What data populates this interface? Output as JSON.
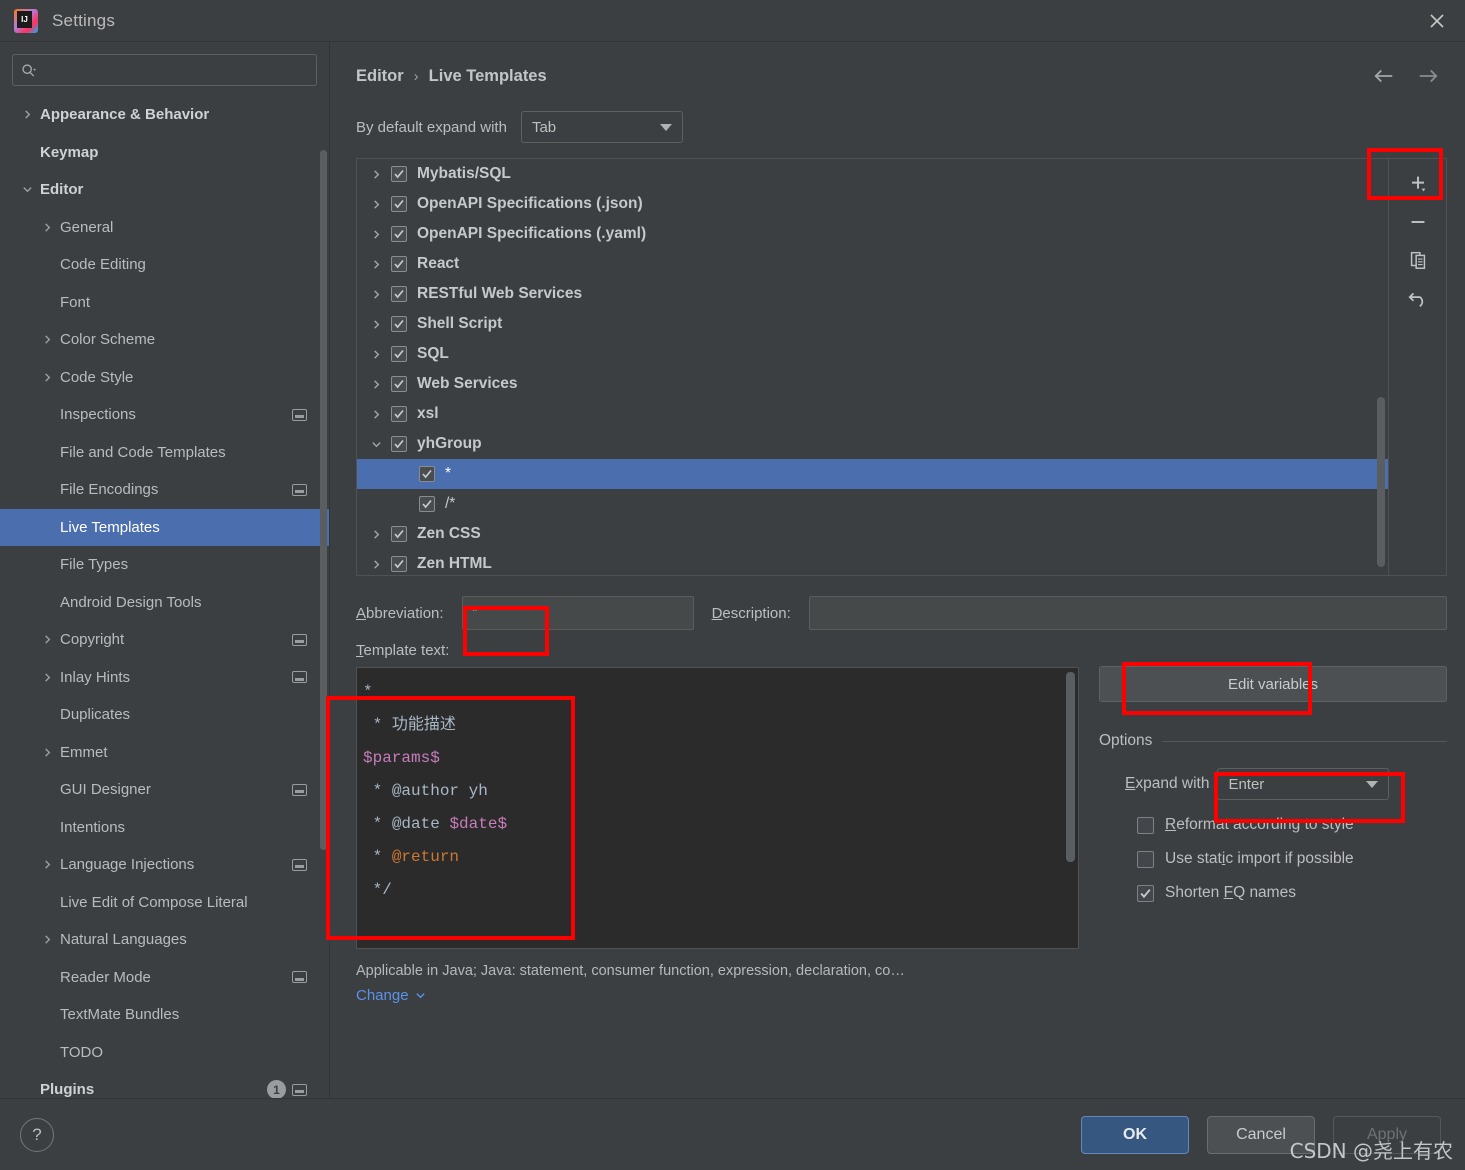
{
  "window": {
    "title": "Settings",
    "logo_icon": "intellij-idea-logo",
    "close_icon": "close-icon"
  },
  "sidebar": {
    "search": {
      "placeholder": "",
      "value": "",
      "icon": "search-icon"
    },
    "items": [
      {
        "label": "Appearance & Behavior",
        "level": 1,
        "arrow": "right",
        "bold": true
      },
      {
        "label": "Keymap",
        "level": 1,
        "arrow": "none",
        "bold": true
      },
      {
        "label": "Editor",
        "level": 1,
        "arrow": "down",
        "bold": true
      },
      {
        "label": "General",
        "level": 2,
        "arrow": "right"
      },
      {
        "label": "Code Editing",
        "level": 2,
        "arrow": "none"
      },
      {
        "label": "Font",
        "level": 2,
        "arrow": "none"
      },
      {
        "label": "Color Scheme",
        "level": 2,
        "arrow": "right"
      },
      {
        "label": "Code Style",
        "level": 2,
        "arrow": "right"
      },
      {
        "label": "Inspections",
        "level": 2,
        "arrow": "none",
        "chip": true
      },
      {
        "label": "File and Code Templates",
        "level": 2,
        "arrow": "none"
      },
      {
        "label": "File Encodings",
        "level": 2,
        "arrow": "none",
        "chip": true
      },
      {
        "label": "Live Templates",
        "level": 2,
        "arrow": "none",
        "selected": true
      },
      {
        "label": "File Types",
        "level": 2,
        "arrow": "none"
      },
      {
        "label": "Android Design Tools",
        "level": 2,
        "arrow": "none"
      },
      {
        "label": "Copyright",
        "level": 2,
        "arrow": "right",
        "chip": true
      },
      {
        "label": "Inlay Hints",
        "level": 2,
        "arrow": "right",
        "chip": true
      },
      {
        "label": "Duplicates",
        "level": 2,
        "arrow": "none"
      },
      {
        "label": "Emmet",
        "level": 2,
        "arrow": "right"
      },
      {
        "label": "GUI Designer",
        "level": 2,
        "arrow": "none",
        "chip": true
      },
      {
        "label": "Intentions",
        "level": 2,
        "arrow": "none"
      },
      {
        "label": "Language Injections",
        "level": 2,
        "arrow": "right",
        "chip": true
      },
      {
        "label": "Live Edit of Compose Literal",
        "level": 2,
        "arrow": "none"
      },
      {
        "label": "Natural Languages",
        "level": 2,
        "arrow": "right"
      },
      {
        "label": "Reader Mode",
        "level": 2,
        "arrow": "none",
        "chip": true
      },
      {
        "label": "TextMate Bundles",
        "level": 2,
        "arrow": "none"
      },
      {
        "label": "TODO",
        "level": 2,
        "arrow": "none"
      },
      {
        "label": "Plugins",
        "level": 1,
        "arrow": "none",
        "bold": true,
        "badge": "1",
        "chip": true
      }
    ]
  },
  "main": {
    "breadcrumb": {
      "parent": "Editor",
      "separator": "›",
      "current": "Live Templates"
    },
    "nav": {
      "back_icon": "arrow-left-icon",
      "forward_icon": "arrow-right-icon"
    },
    "expand_default": {
      "label": "By default expand with",
      "value": "Tab"
    },
    "template_tree": [
      {
        "label": "Mybatis/SQL",
        "arrow": "right",
        "checked": true,
        "level": 1
      },
      {
        "label": "OpenAPI Specifications (.json)",
        "arrow": "right",
        "checked": true,
        "level": 1
      },
      {
        "label": "OpenAPI Specifications (.yaml)",
        "arrow": "right",
        "checked": true,
        "level": 1
      },
      {
        "label": "React",
        "arrow": "right",
        "checked": true,
        "level": 1
      },
      {
        "label": "RESTful Web Services",
        "arrow": "right",
        "checked": true,
        "level": 1
      },
      {
        "label": "Shell Script",
        "arrow": "right",
        "checked": true,
        "level": 1
      },
      {
        "label": "SQL",
        "arrow": "right",
        "checked": true,
        "level": 1
      },
      {
        "label": "Web Services",
        "arrow": "right",
        "checked": true,
        "level": 1
      },
      {
        "label": "xsl",
        "arrow": "right",
        "checked": true,
        "level": 1
      },
      {
        "label": "yhGroup",
        "arrow": "down",
        "checked": true,
        "level": 1
      },
      {
        "label": "*",
        "arrow": "none",
        "checked": true,
        "level": 2,
        "selected": true
      },
      {
        "label": "/*",
        "arrow": "none",
        "checked": true,
        "level": 2
      },
      {
        "label": "Zen CSS",
        "arrow": "right",
        "checked": true,
        "level": 1
      },
      {
        "label": "Zen HTML",
        "arrow": "right",
        "checked": true,
        "level": 1
      }
    ],
    "toolbar": [
      {
        "name": "add-button",
        "icon": "plus-icon"
      },
      {
        "name": "remove-button",
        "icon": "minus-icon"
      },
      {
        "name": "duplicate-button",
        "icon": "copy-icon"
      },
      {
        "name": "revert-button",
        "icon": "undo-icon"
      }
    ],
    "abbreviation": {
      "label": "Abbreviation:",
      "value": "*"
    },
    "description": {
      "label": "Description:",
      "value": ""
    },
    "template_text": {
      "label": "Template text:",
      "lines": [
        [
          {
            "t": "*",
            "c": "#a9b7c6"
          }
        ],
        [
          {
            "t": " * ",
            "c": "#a9b7c6"
          },
          {
            "t": "功能描述",
            "c": "#a9b7c6"
          }
        ],
        [
          {
            "t": "$params$",
            "c": "#c77dbb"
          }
        ],
        [
          {
            "t": " * ",
            "c": "#a9b7c6"
          },
          {
            "t": "@author",
            "c": "#a9b7c6"
          },
          {
            "t": " yh",
            "c": "#a9b7c6"
          }
        ],
        [
          {
            "t": " * ",
            "c": "#a9b7c6"
          },
          {
            "t": "@date",
            "c": "#a9b7c6"
          },
          {
            "t": " ",
            "c": "#a9b7c6"
          },
          {
            "t": "$date$",
            "c": "#c77dbb"
          }
        ],
        [
          {
            "t": " * ",
            "c": "#a9b7c6"
          },
          {
            "t": "@return",
            "c": "#cc7832"
          }
        ],
        [
          {
            "t": " */",
            "c": "#a9b7c6"
          }
        ]
      ]
    },
    "applicable": "Applicable in Java; Java: statement, consumer function, expression, declaration, co…",
    "change_link": "Change",
    "edit_variables_button": "Edit variables",
    "options": {
      "legend": "Options",
      "expand_with": {
        "label": "Expand with",
        "value": "Enter"
      },
      "checkboxes": [
        {
          "label": "Reformat according to style",
          "checked": false
        },
        {
          "label": "Use static import if possible",
          "checked": false
        },
        {
          "label": "Shorten FQ names",
          "checked": true
        }
      ]
    }
  },
  "footer": {
    "help_label": "?",
    "ok": "OK",
    "cancel": "Cancel",
    "apply": "Apply"
  },
  "watermark": "CSDN @尧上有农",
  "colors": {
    "accent": "#4b6eaf",
    "primary_button": "#365880",
    "annotation": "#fe0000",
    "background": "#3c3f41",
    "editor_background": "#2b2b2b",
    "link": "#5a93e8"
  }
}
